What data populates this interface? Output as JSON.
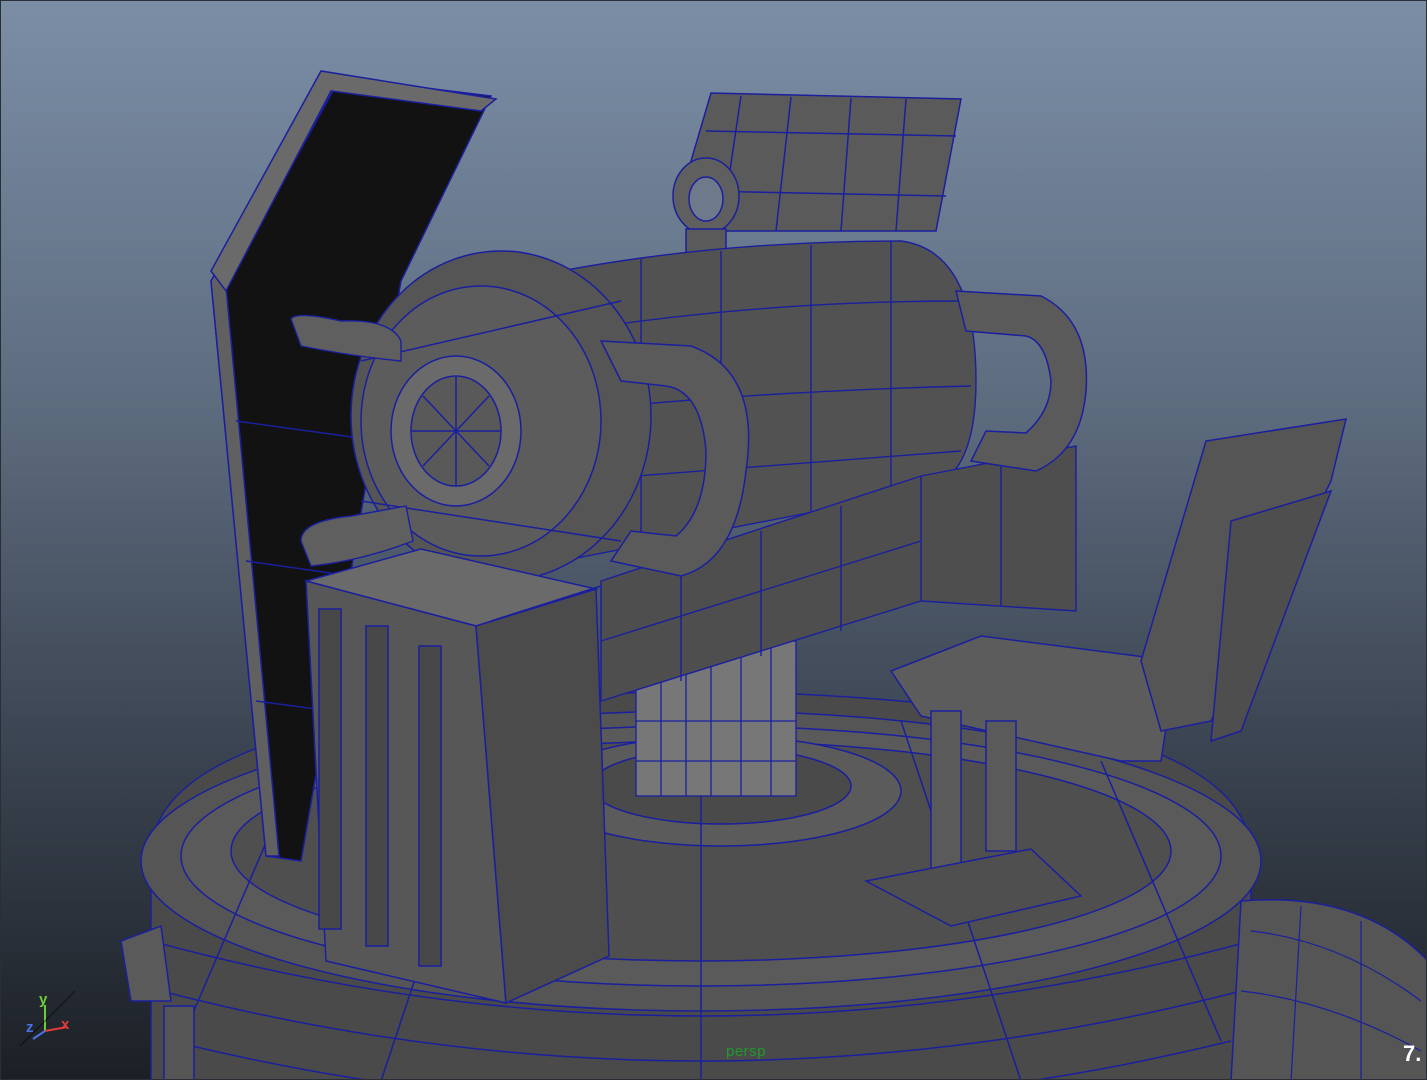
{
  "viewport": {
    "camera_name": "persp",
    "fps_readout": "7.",
    "axis": {
      "x": "x",
      "y": "y",
      "z": "z"
    },
    "colors": {
      "background_top": "#7b8ea6",
      "background_bottom": "#1c2026",
      "wireframe": "#1a1f9e",
      "shaded_surface": "#505050",
      "axis_x": "#e23a3a",
      "axis_y": "#6ccf3a",
      "axis_z": "#4a70e6",
      "camera_label": "#1f9a2a"
    },
    "display_mode": "wireframe-on-shaded"
  }
}
